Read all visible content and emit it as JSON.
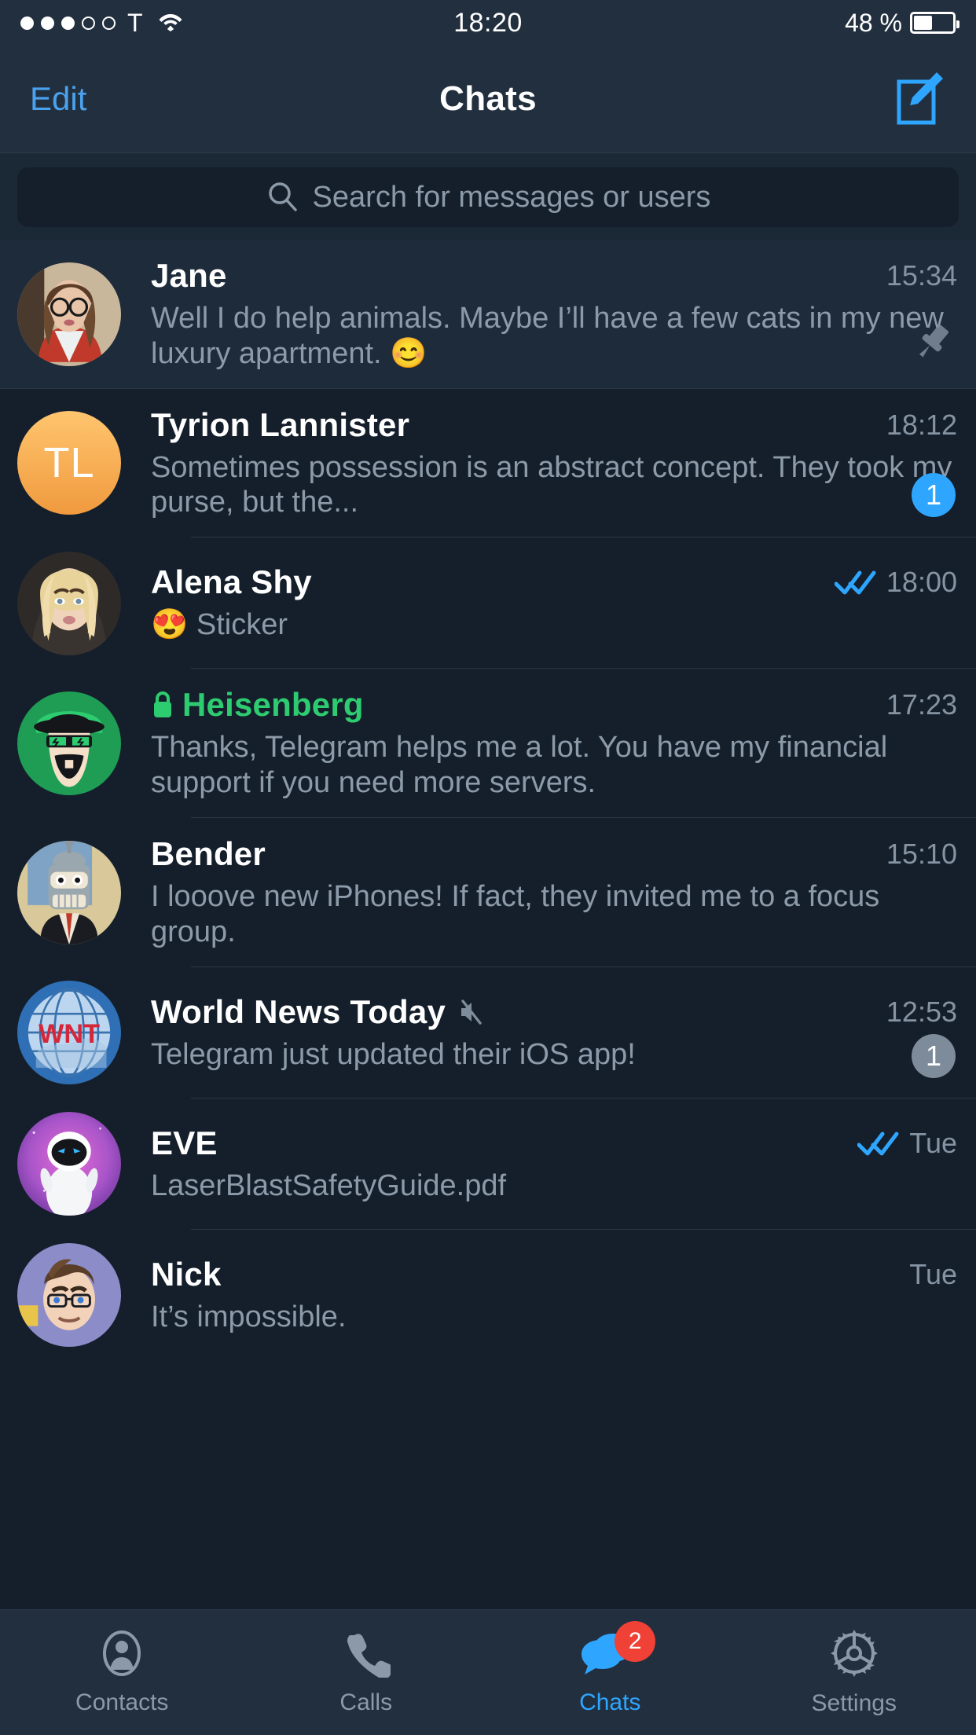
{
  "status_bar": {
    "signal_dots_filled": 3,
    "signal_dots_total": 5,
    "carrier": "T",
    "wifi_icon": "wifi-icon",
    "time": "18:20",
    "battery_percent": "48 %"
  },
  "nav": {
    "edit_label": "Edit",
    "title": "Chats",
    "compose_icon": "compose-icon"
  },
  "search": {
    "placeholder": "Search for messages or users",
    "icon": "search-icon"
  },
  "chats": [
    {
      "name": "Jane",
      "message": "Well I do help animals. Maybe I’ll have a few cats in my new luxury apartment. 😊",
      "time": "15:34",
      "pinned": true,
      "avatar_type": "photo-jane",
      "badge": null,
      "secret": false,
      "muted": false,
      "read_receipt": false
    },
    {
      "name": "Tyrion Lannister",
      "message": "Sometimes possession is an abstract concept. They took my purse, but the...",
      "time": "18:12",
      "pinned": false,
      "avatar_type": "initials",
      "avatar_initials": "TL",
      "badge": "1",
      "badge_muted": false,
      "secret": false,
      "muted": false,
      "read_receipt": false
    },
    {
      "name": "Alena Shy",
      "message": "😍 Sticker",
      "time": "18:00",
      "pinned": false,
      "avatar_type": "photo-alena",
      "badge": null,
      "secret": false,
      "muted": false,
      "read_receipt": true
    },
    {
      "name": "Heisenberg",
      "message": "Thanks, Telegram helps me a lot. You have my financial support if you need more servers.",
      "time": "17:23",
      "pinned": false,
      "avatar_type": "photo-heisenberg",
      "badge": null,
      "secret": true,
      "muted": false,
      "read_receipt": false
    },
    {
      "name": "Bender",
      "message": "I looove new iPhones! If fact, they invited me to a focus group.",
      "time": "15:10",
      "pinned": false,
      "avatar_type": "photo-bender",
      "badge": null,
      "secret": false,
      "muted": false,
      "read_receipt": false
    },
    {
      "name": "World News Today",
      "message": "Telegram just updated their iOS app!",
      "time": "12:53",
      "pinned": false,
      "avatar_type": "photo-wnt",
      "badge": "1",
      "badge_muted": true,
      "secret": false,
      "muted": true,
      "read_receipt": false
    },
    {
      "name": "EVE",
      "message": "LaserBlastSafetyGuide.pdf",
      "time": "Tue",
      "pinned": false,
      "avatar_type": "photo-eve",
      "badge": null,
      "secret": false,
      "muted": false,
      "read_receipt": true
    },
    {
      "name": "Nick",
      "message": "It’s impossible.",
      "time": "Tue",
      "pinned": false,
      "avatar_type": "photo-nick",
      "badge": null,
      "secret": false,
      "muted": false,
      "read_receipt": false
    }
  ],
  "tabs": [
    {
      "label": "Contacts",
      "icon": "contacts-icon",
      "active": false,
      "badge": null
    },
    {
      "label": "Calls",
      "icon": "phone-icon",
      "active": false,
      "badge": null
    },
    {
      "label": "Chats",
      "icon": "chat-bubbles-icon",
      "active": true,
      "badge": "2"
    },
    {
      "label": "Settings",
      "icon": "gear-icon",
      "active": false,
      "badge": null
    }
  ],
  "colors": {
    "accent_blue": "#2ea6ff",
    "secret_green": "#2ecc71",
    "badge_red": "#ef4136",
    "bar_background": "#222f3f",
    "list_background": "#151f2b",
    "pinned_background": "#1e2b3a"
  }
}
